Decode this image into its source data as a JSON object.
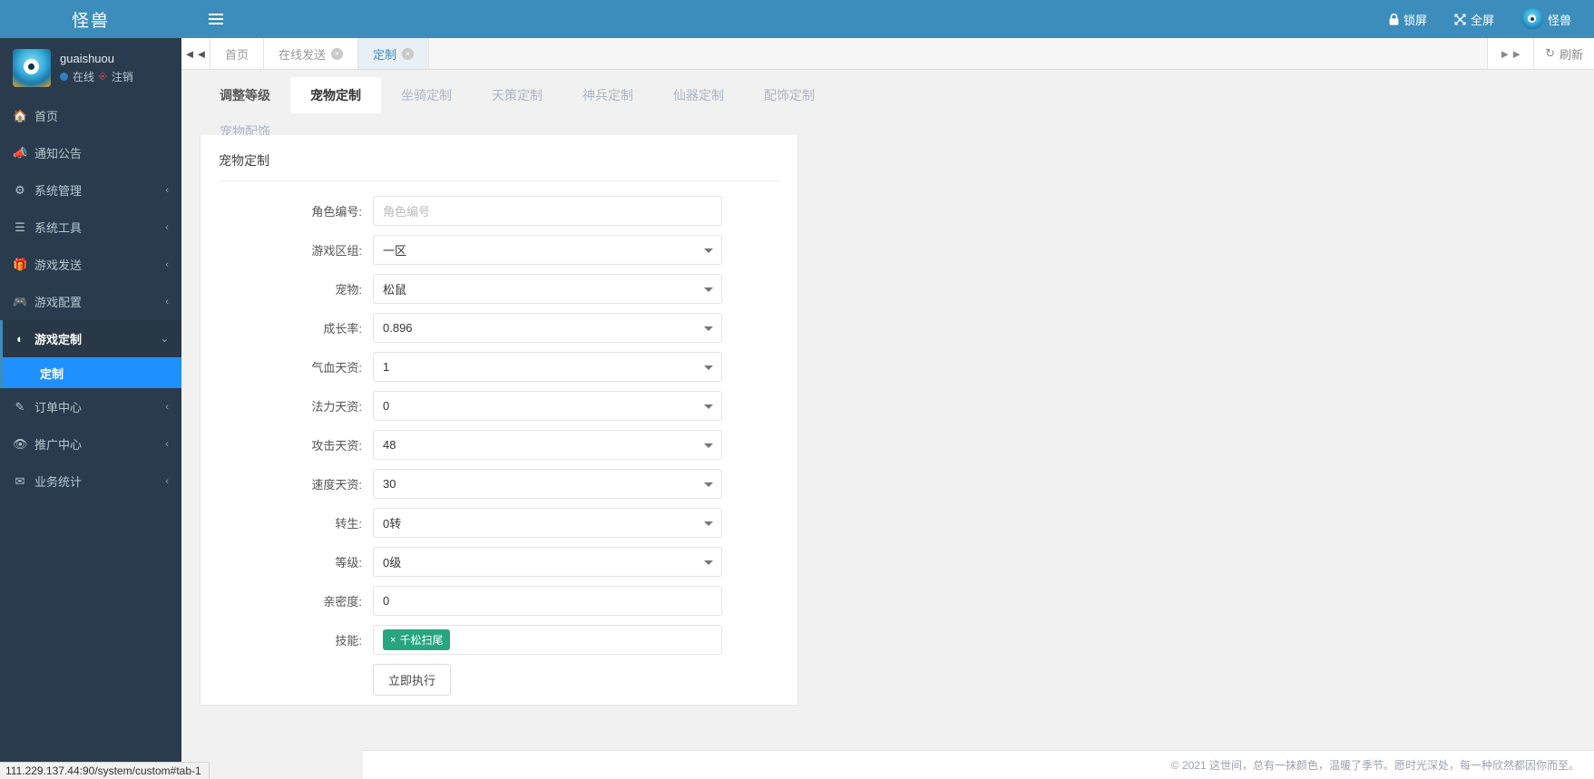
{
  "header": {
    "brand": "怪兽",
    "menu_toggle_icon": "hamburger-icon",
    "right_items": [
      {
        "label": "锁屏",
        "icon": "lock-icon"
      },
      {
        "label": "全屏",
        "icon": "expand-icon"
      },
      {
        "label": "怪兽",
        "icon": "avatar"
      }
    ]
  },
  "sidebar": {
    "user": {
      "name": "guaishuou",
      "status": "在线",
      "logout": "注销"
    },
    "items": [
      {
        "label": "首页",
        "icon": "home-icon",
        "arrow": ""
      },
      {
        "label": "通知公告",
        "icon": "megaphone-icon",
        "arrow": ""
      },
      {
        "label": "系统管理",
        "icon": "gear-icon",
        "arrow": "‹"
      },
      {
        "label": "系统工具",
        "icon": "list-icon",
        "arrow": "‹"
      },
      {
        "label": "游戏发送",
        "icon": "gift-icon",
        "arrow": "‹"
      },
      {
        "label": "游戏配置",
        "icon": "gamepad-icon",
        "arrow": "‹"
      },
      {
        "label": "游戏定制",
        "icon": "cube-icon",
        "arrow": "⌄",
        "open": true
      },
      {
        "label": "订单中心",
        "icon": "pen-icon",
        "arrow": "‹"
      },
      {
        "label": "推广中心",
        "icon": "eye-icon",
        "arrow": "‹"
      },
      {
        "label": "业务统计",
        "icon": "envelope-icon",
        "arrow": "‹"
      }
    ],
    "submenu": [
      {
        "label": "定制",
        "active": true
      }
    ]
  },
  "tabbar": {
    "collapse_icon": "double-chevron-left-icon",
    "expand_icon": "double-chevron-right-icon",
    "refresh_label": "刷新",
    "refresh_icon": "refresh-icon",
    "close_glyph": "×",
    "tabs": [
      {
        "label": "首页",
        "closable": false,
        "active": false
      },
      {
        "label": "在线发送",
        "closable": true,
        "active": false
      },
      {
        "label": "定制",
        "closable": true,
        "active": true
      }
    ]
  },
  "subtabs": [
    {
      "label": "调整等级",
      "active": false,
      "strong": true
    },
    {
      "label": "宠物定制",
      "active": true,
      "strong": false
    },
    {
      "label": "坐骑定制",
      "active": false,
      "strong": false
    },
    {
      "label": "天策定制",
      "active": false,
      "strong": false
    },
    {
      "label": "神兵定制",
      "active": false,
      "strong": false
    },
    {
      "label": "仙器定制",
      "active": false,
      "strong": false
    },
    {
      "label": "配饰定制",
      "active": false,
      "strong": false
    },
    {
      "label": "宠物配饰",
      "active": false,
      "strong": false
    }
  ],
  "form": {
    "title": "宠物定制",
    "fields": [
      {
        "label": "角色编号:",
        "value": "",
        "placeholder": "角色编号",
        "type": "input"
      },
      {
        "label": "游戏区组:",
        "value": "一区",
        "type": "select"
      },
      {
        "label": "宠物:",
        "value": "松鼠",
        "type": "select"
      },
      {
        "label": "成长率:",
        "value": "0.896",
        "type": "select"
      },
      {
        "label": "气血天资:",
        "value": "1",
        "type": "select"
      },
      {
        "label": "法力天资:",
        "value": "0",
        "type": "select"
      },
      {
        "label": "攻击天资:",
        "value": "48",
        "type": "select"
      },
      {
        "label": "速度天资:",
        "value": "30",
        "type": "select"
      },
      {
        "label": "转生:",
        "value": "0转",
        "type": "select"
      },
      {
        "label": "等级:",
        "value": "0级",
        "type": "select"
      },
      {
        "label": "亲密度:",
        "value": "0",
        "type": "input"
      }
    ],
    "skill_label": "技能:",
    "skill_tags": [
      {
        "remove": "×",
        "label": "千松扫尾"
      }
    ],
    "submit_label": "立即执行"
  },
  "footer": {
    "copyright": "© 2021 这世间，总有一抹颜色，温暖了季节。愿时光深处，每一种欣然都因你而至。"
  },
  "statusbar": {
    "url": "111.229.137.44:90/system/custom#tab-1"
  }
}
